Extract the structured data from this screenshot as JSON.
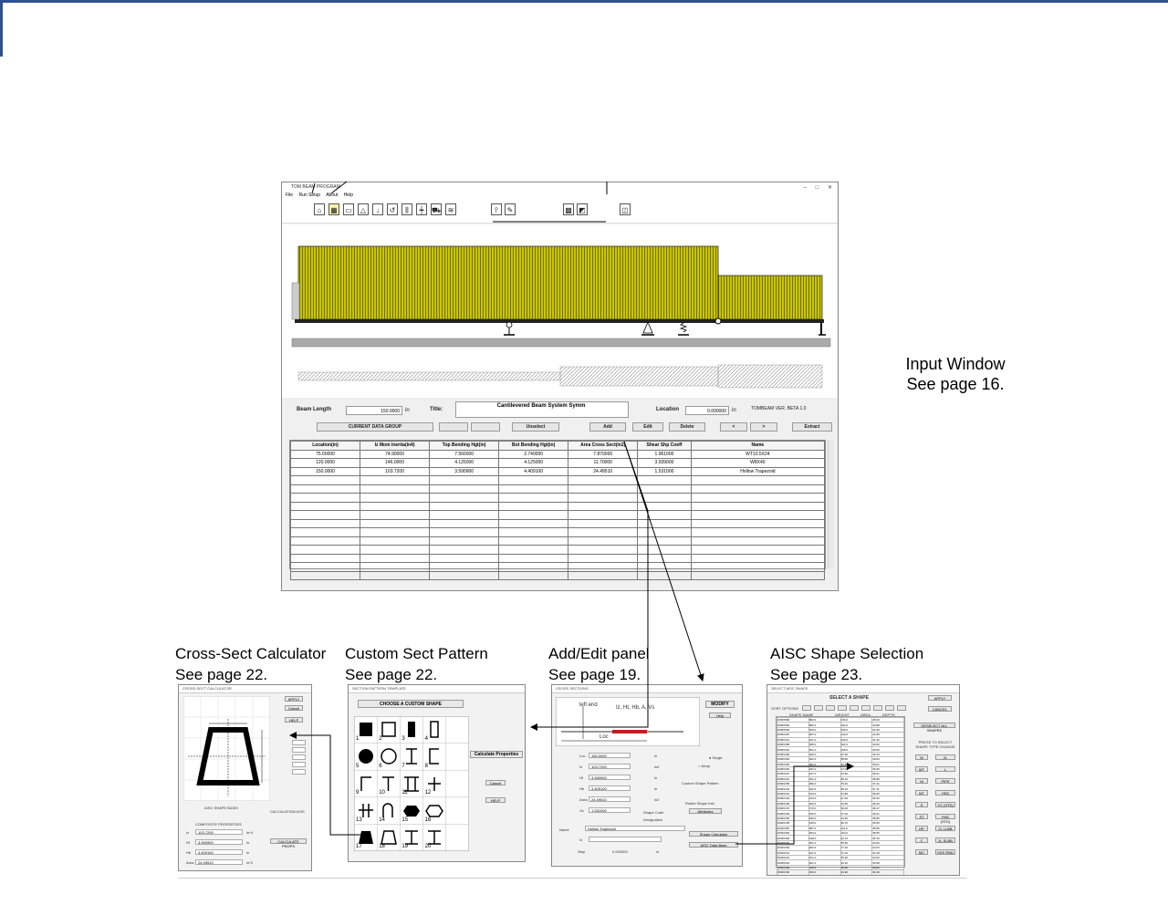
{
  "captions": {
    "input_window_line1": "Input Window",
    "input_window_line2": "See page 16.",
    "cross_sect_line1": "Cross-Sect Calculator",
    "cross_sect_line2": "See page 22.",
    "custom_sect_line1": "Custom Sect Pattern",
    "custom_sect_line2": "See page 22.",
    "add_edit_line1": "Add/Edit panel",
    "add_edit_line2": "See page 19.",
    "aisc_line1": "AISC Shape Selection",
    "aisc_line2": "See page 23."
  },
  "main_window": {
    "title": "TOM BEAM PROGRAM",
    "window_controls": "– □ ✕",
    "menu": [
      "File",
      "Run Setup",
      "About",
      "Help"
    ],
    "form": {
      "beam_length_label": "Beam Length",
      "beam_length_value": "150.0000",
      "beam_length_unit": "in",
      "title_label": "Title:",
      "title_value": "Cantilevered Beam System Symm",
      "location_label": "Location",
      "location_value": "0.000000",
      "location_unit": "in",
      "version": "TOMBEAM VER. BETA 1.0"
    },
    "buttons": {
      "current_data_group": "CURRENT DATA GROUP",
      "unselect": "Unselect",
      "add": "Add",
      "edit": "Edit",
      "delete": "Delete",
      "prev": "<",
      "next": ">",
      "extract": "Extract"
    },
    "table": {
      "headers": [
        "Location(in)",
        "Iz Mom Inertia(in4)",
        "Top Bending Hgt(in)",
        "Bot Bending Hgt(in)",
        "Area Cross Sect(in2)",
        "Shear Shp Coeff",
        "Name"
      ],
      "rows": [
        [
          "75.00000",
          "74.90000",
          "7.560000",
          "2.740000",
          "7.870000",
          "1.961000",
          "WT10.5X24"
        ],
        [
          "120.0000",
          "146.0000",
          "4.125000",
          "4.125000",
          "11.70000",
          "3.939000",
          "W8X40"
        ],
        [
          "150.0000",
          "103.7200",
          "3.590900",
          "4.409100",
          "24.49510",
          "1.531000",
          "Hollow Trapezoid"
        ]
      ]
    }
  },
  "cross_sect_calc": {
    "title": "CROSS-SECT CALCULATOR",
    "apply": "APPLY",
    "cancel": "Cancel",
    "help": "HELP",
    "shape_basis": "AISC SHAPE BASIS",
    "composite_properties": "COMPOSITE PROPERTIES",
    "calc_axis": "CALCULATION AXIS",
    "calc_button": "CALCULATE PROPS",
    "props": [
      {
        "label": "Iz",
        "value": "103.7200",
        "unit": "in^4"
      },
      {
        "label": "Ht",
        "value": "3.590900",
        "unit": "in"
      },
      {
        "label": "Hb",
        "value": "4.409100",
        "unit": "in"
      },
      {
        "label": "Area",
        "value": "24.49510",
        "unit": "in^2"
      }
    ]
  },
  "custom_pattern": {
    "title": "SECTION PATTERN TEMPLATE",
    "choose": "CHOOSE A CUSTOM SHAPE",
    "calc_props": "Calculate Properties",
    "cancel": "Cancel",
    "help": "HELP",
    "numbers": [
      "1",
      "2",
      "3",
      "4",
      "5",
      "6",
      "7",
      "8",
      "9",
      "10",
      "11",
      "12",
      "13",
      "14",
      "15",
      "16",
      "17",
      "18",
      "19",
      "20"
    ]
  },
  "add_edit": {
    "title": "CROSS SECTIONS",
    "modify": "MODIFY",
    "help": "Help",
    "diagram_left": "left end",
    "diagram_props": "Iz, Ht, Hb, A, Vs",
    "diagram_loc": "Loc",
    "fields": [
      {
        "label": "Loc",
        "value": "150.0000",
        "unit": "in"
      },
      {
        "label": "Iz",
        "value": "103.7200",
        "unit": "in4"
      },
      {
        "label": "Ht",
        "value": "3.590900",
        "unit": "in"
      },
      {
        "label": "Hb",
        "value": "4.409100",
        "unit": "in"
      },
      {
        "label": "Area",
        "value": "24.49510",
        "unit": "in2"
      },
      {
        "label": "Vs",
        "value": "1.531000",
        "unit": ""
      }
    ],
    "single": "Single",
    "array": "Array",
    "custom_shape_pattern": "Custom Shape Pattern",
    "rolled_shape_info": "Rolled Shape Info",
    "attributes": "Attributes",
    "shape_code": "Shape Code",
    "designation": "Designation",
    "name_label": "Name",
    "name_value": "Hollow Trapezoid",
    "n_label": "N",
    "step_label": "Step",
    "step_value": "0.000000",
    "step_unit": "in",
    "shape_calc": "Shape Calculator",
    "aisc_db": "AISC Data Base"
  },
  "aisc": {
    "title": "SELECT AISC SHAPE",
    "heading": "SELECT A SHAPE",
    "sort_label": "SORT OPTIONS",
    "apply": "APPLY",
    "cancel": "CANCEL",
    "deselect": "DESELECT ALL SHAPES",
    "press_to_select": "PRESS TO SELECT SHAPE TYPE CHANGE",
    "type_buttons": [
      "W",
      "WT",
      "M",
      "MT",
      "S",
      "ST",
      "HP",
      "C",
      "MC",
      "2L",
      "L",
      "PIPE",
      "HSS",
      "YC (STD)",
      "YMC (STD)",
      "2L LLBB",
      "2L SLBB",
      "HSS RND"
    ],
    "columns": [
      "SHAPE NAME",
      "WEIGHT",
      "AREA",
      "DEPTH"
    ],
    "rows": [
      [
        "W36X800",
        "800.0",
        "236.0",
        "45.63"
      ],
      [
        "W36X652",
        "652.0",
        "192.0",
        "43.88"
      ],
      [
        "W36X529",
        "529.0",
        "156.0",
        "42.28"
      ],
      [
        "W36X487",
        "487.0",
        "143.0",
        "41.86"
      ],
      [
        "W36X441",
        "441.0",
        "130.0",
        "41.36"
      ],
      [
        "W36X395",
        "395.0",
        "116.0",
        "40.93"
      ],
      [
        "W36X361",
        "361.0",
        "106.0",
        "40.55"
      ],
      [
        "W36X330",
        "330.0",
        "97.00",
        "40.16"
      ],
      [
        "W36X302",
        "302.0",
        "88.80",
        "39.84"
      ],
      [
        "W36X282",
        "282.0",
        "82.90",
        "39.61"
      ],
      [
        "W36X262",
        "262.0",
        "77.00",
        "39.36"
      ],
      [
        "W36X247",
        "247.0",
        "72.50",
        "39.21"
      ],
      [
        "W36X231",
        "231.0",
        "68.10",
        "38.98"
      ],
      [
        "W36X256",
        "256.0",
        "75.40",
        "37.41"
      ],
      [
        "W36X232",
        "232.0",
        "68.10",
        "37.11"
      ],
      [
        "W36X210",
        "210.0",
        "61.80",
        "36.65"
      ],
      [
        "W36X194",
        "194.0",
        "57.00",
        "36.49"
      ],
      [
        "W36X182",
        "182.0",
        "53.60",
        "36.33"
      ],
      [
        "W36X170",
        "170.0",
        "50.00",
        "36.17"
      ],
      [
        "W36X160",
        "160.0",
        "47.00",
        "36.01"
      ],
      [
        "W36X150",
        "150.0",
        "44.20",
        "35.85"
      ],
      [
        "W36X135",
        "135.0",
        "39.70",
        "35.55"
      ],
      [
        "W33X387",
        "387.0",
        "114.0",
        "35.95"
      ],
      [
        "W33X354",
        "354.0",
        "104.0",
        "35.55"
      ],
      [
        "W33X318",
        "318.0",
        "93.70",
        "35.16"
      ],
      [
        "W33X291",
        "291.0",
        "85.60",
        "34.84"
      ],
      [
        "W33X263",
        "263.0",
        "77.40",
        "34.53"
      ],
      [
        "W33X241",
        "241.0",
        "71.10",
        "34.18"
      ],
      [
        "W33X221",
        "221.0",
        "65.30",
        "33.93"
      ],
      [
        "W33X201",
        "201.0",
        "59.10",
        "33.68"
      ],
      [
        "W33X169",
        "169.0",
        "49.50",
        "33.82"
      ],
      [
        "W33X152",
        "152.0",
        "44.90",
        "33.49"
      ],
      [
        "W33X141",
        "141.0",
        "41.60",
        "33.30"
      ],
      [
        "W33X130",
        "130.0",
        "38.30",
        "33.09"
      ],
      [
        "W33X118",
        "118.0",
        "34.70",
        "32.86"
      ],
      [
        "W30X391",
        "391.0",
        "115.0",
        "33.19"
      ]
    ]
  }
}
